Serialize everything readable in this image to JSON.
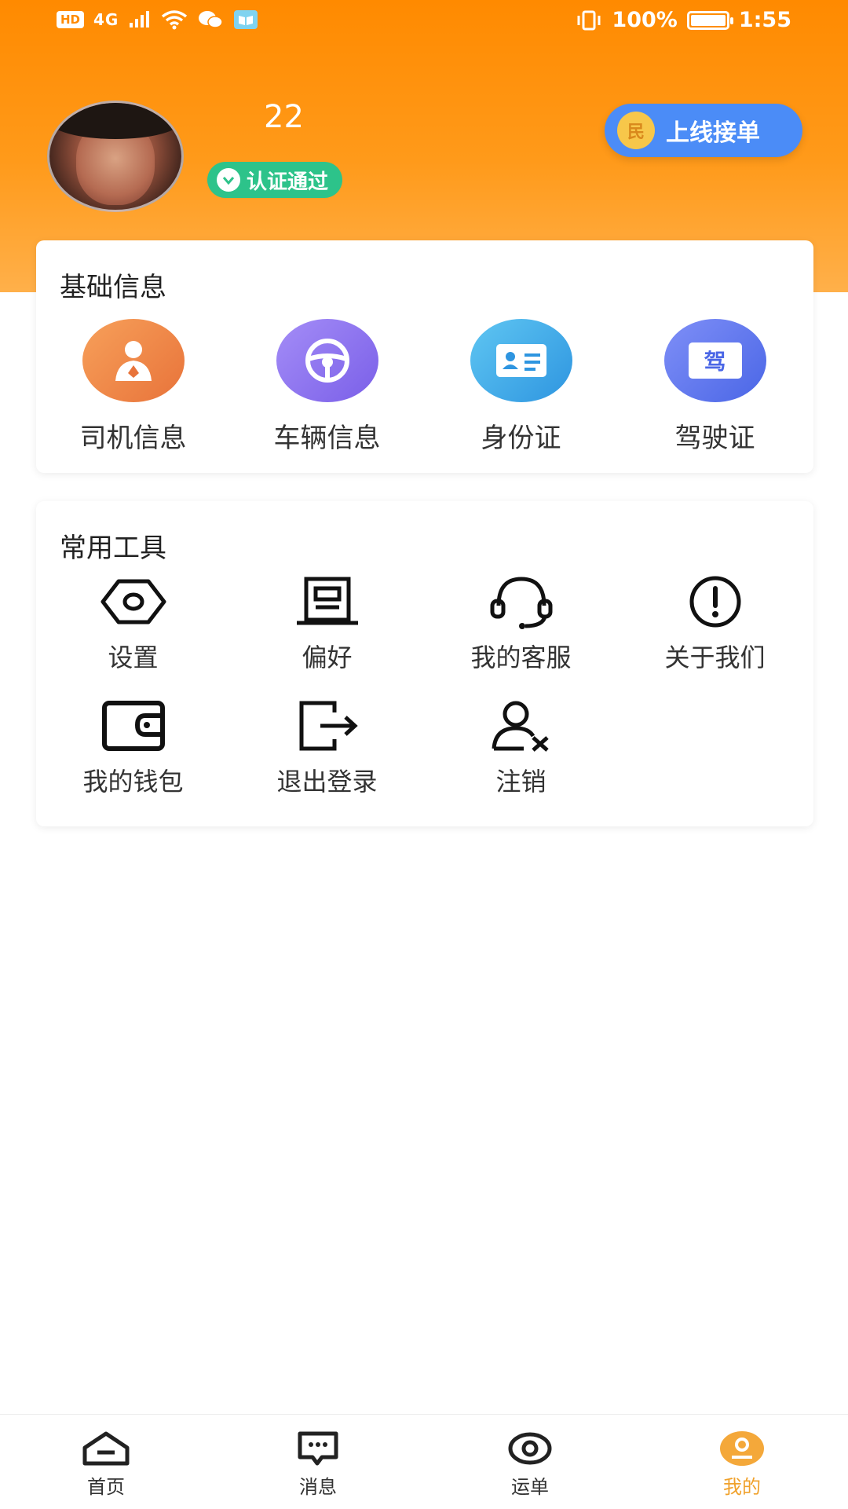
{
  "status_bar": {
    "left_badge": "HD",
    "network": "4G",
    "battery": "100%",
    "time": "1:55"
  },
  "profile": {
    "name": "22",
    "verified_text": "认证通过",
    "online_button": "上线接单",
    "online_icon_glyph": "民"
  },
  "basic_info": {
    "title": "基础信息",
    "items": [
      {
        "label": "司机信息",
        "icon": "driver-icon",
        "color": "#f08a3c"
      },
      {
        "label": "车辆信息",
        "icon": "steering-wheel-icon",
        "color": "#8a6ff0"
      },
      {
        "label": "身份证",
        "icon": "id-card-icon",
        "color": "#3fa9e8"
      },
      {
        "label": "驾驶证",
        "icon": "license-icon",
        "color": "#5a7df0",
        "badge_text": "驾"
      }
    ]
  },
  "tools": {
    "title": "常用工具",
    "items": [
      {
        "label": "设置",
        "icon": "settings-icon"
      },
      {
        "label": "偏好",
        "icon": "preference-icon"
      },
      {
        "label": "我的客服",
        "icon": "headset-icon"
      },
      {
        "label": "关于我们",
        "icon": "info-icon"
      },
      {
        "label": "我的钱包",
        "icon": "wallet-icon"
      },
      {
        "label": "退出登录",
        "icon": "logout-icon"
      },
      {
        "label": "注销",
        "icon": "delete-user-icon"
      }
    ]
  },
  "bottom_nav": [
    {
      "label": "首页",
      "icon": "home-icon",
      "active": false
    },
    {
      "label": "消息",
      "icon": "message-icon",
      "active": false
    },
    {
      "label": "运单",
      "icon": "waybill-icon",
      "active": false
    },
    {
      "label": "我的",
      "icon": "profile-icon",
      "active": true
    }
  ],
  "colors": {
    "header_orange": "#ff8a00",
    "verified_green": "#2dc38a",
    "online_blue": "#4b8cf7",
    "active_tab": "#f0a12b"
  }
}
